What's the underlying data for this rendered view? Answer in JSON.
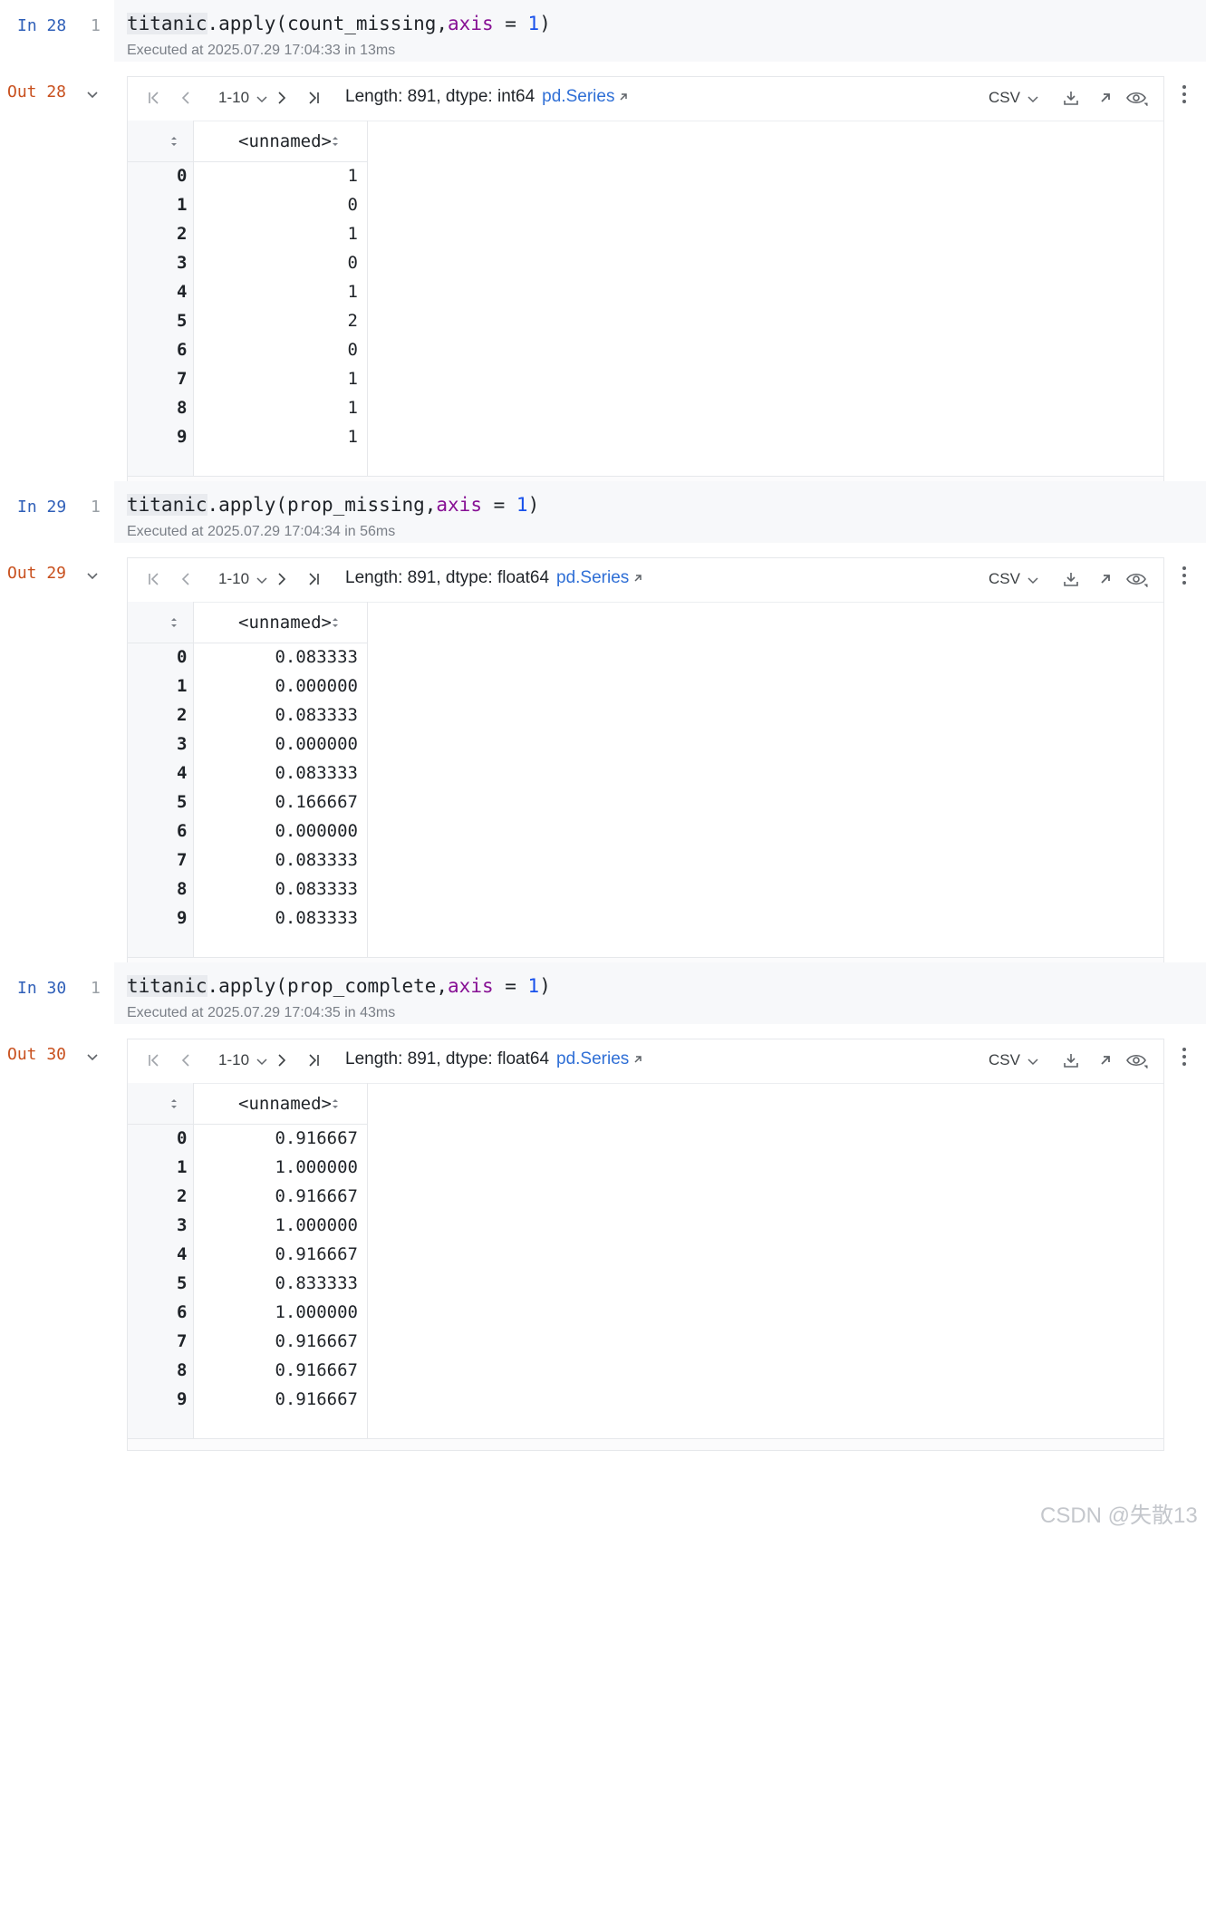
{
  "cells": [
    {
      "in_label": "In 28",
      "line_no": "1",
      "code": {
        "var": "titanic",
        "call": ".apply(count_missing,",
        "kw": "axis",
        "eq": " = ",
        "num": "1",
        "close": ")"
      },
      "executed": "Executed at 2025.07.29 17:04:33 in 13ms",
      "out_label": "Out 28",
      "range": "1-10",
      "length_text": "Length: 891, dtype: int64",
      "link": "pd.Series",
      "csv": "CSV",
      "column": "<unnamed>",
      "rows": [
        {
          "i": "0",
          "v": "1"
        },
        {
          "i": "1",
          "v": "0"
        },
        {
          "i": "2",
          "v": "1"
        },
        {
          "i": "3",
          "v": "0"
        },
        {
          "i": "4",
          "v": "1"
        },
        {
          "i": "5",
          "v": "2"
        },
        {
          "i": "6",
          "v": "0"
        },
        {
          "i": "7",
          "v": "1"
        },
        {
          "i": "8",
          "v": "1"
        },
        {
          "i": "9",
          "v": "1"
        }
      ]
    },
    {
      "in_label": "In 29",
      "line_no": "1",
      "code": {
        "var": "titanic",
        "call": ".apply(prop_missing,",
        "kw": "axis",
        "eq": " = ",
        "num": "1",
        "close": ")"
      },
      "executed": "Executed at 2025.07.29 17:04:34 in 56ms",
      "out_label": "Out 29",
      "range": "1-10",
      "length_text": "Length: 891, dtype: float64",
      "link": "pd.Series",
      "csv": "CSV",
      "column": "<unnamed>",
      "rows": [
        {
          "i": "0",
          "v": "0.083333"
        },
        {
          "i": "1",
          "v": "0.000000"
        },
        {
          "i": "2",
          "v": "0.083333"
        },
        {
          "i": "3",
          "v": "0.000000"
        },
        {
          "i": "4",
          "v": "0.083333"
        },
        {
          "i": "5",
          "v": "0.166667"
        },
        {
          "i": "6",
          "v": "0.000000"
        },
        {
          "i": "7",
          "v": "0.083333"
        },
        {
          "i": "8",
          "v": "0.083333"
        },
        {
          "i": "9",
          "v": "0.083333"
        }
      ]
    },
    {
      "in_label": "In 30",
      "line_no": "1",
      "code": {
        "var": "titanic",
        "call": ".apply(prop_complete,",
        "kw": "axis",
        "eq": " = ",
        "num": "1",
        "close": ")"
      },
      "executed": "Executed at 2025.07.29 17:04:35 in 43ms",
      "out_label": "Out 30",
      "range": "1-10",
      "length_text": "Length: 891, dtype: float64",
      "link": "pd.Series",
      "csv": "CSV",
      "column": "<unnamed>",
      "rows": [
        {
          "i": "0",
          "v": "0.916667"
        },
        {
          "i": "1",
          "v": "1.000000"
        },
        {
          "i": "2",
          "v": "0.916667"
        },
        {
          "i": "3",
          "v": "1.000000"
        },
        {
          "i": "4",
          "v": "0.916667"
        },
        {
          "i": "5",
          "v": "0.833333"
        },
        {
          "i": "6",
          "v": "1.000000"
        },
        {
          "i": "7",
          "v": "0.916667"
        },
        {
          "i": "8",
          "v": "0.916667"
        },
        {
          "i": "9",
          "v": "0.916667"
        }
      ]
    }
  ],
  "icons": {
    "collapse": "chevron-down-icon",
    "first": "first-page-icon",
    "prev": "prev-page-icon",
    "next": "next-page-icon",
    "last": "last-page-icon",
    "download": "download-icon",
    "open": "open-external-icon",
    "view": "eye-icon",
    "more": "more-vertical-icon"
  },
  "colors": {
    "in_label": "#2f5fb8",
    "out_label": "#c8501e",
    "keyword": "#871094",
    "number": "#1750eb",
    "link": "#2f6fd6"
  },
  "watermark": "CSDN @失散13"
}
